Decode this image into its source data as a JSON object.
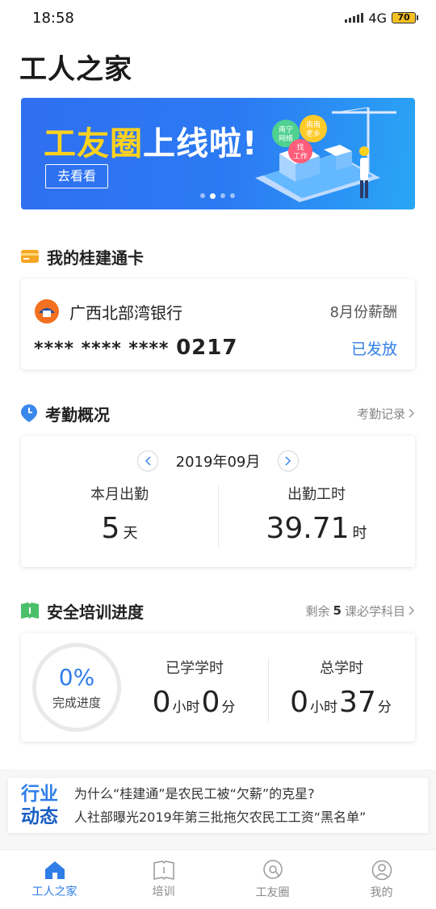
{
  "status": {
    "time": "18:58",
    "network": "4G",
    "battery": "70"
  },
  "header": {
    "title": "工人之家"
  },
  "banner": {
    "headline_part1": "工友圈",
    "headline_part2": "上线啦",
    "headline_mark": "!",
    "cta": "去看看",
    "art_labels": [
      "南宁",
      "网络",
      "南南",
      "老乡",
      "找",
      "工作"
    ]
  },
  "card_section": {
    "title": "我的桂建通卡",
    "bank_name": "广西北部湾银行",
    "salary_label": "8月份薪酬",
    "card_mask": "**** **** ****",
    "card_last4": "0217",
    "status": "已发放"
  },
  "attendance": {
    "title": "考勤概况",
    "link": "考勤记录",
    "month": "2019年09月",
    "days_label": "本月出勤",
    "days_value": "5",
    "days_unit": "天",
    "hours_label": "出勤工时",
    "hours_value": "39.71",
    "hours_unit": "时"
  },
  "training": {
    "title": "安全培训进度",
    "link_prefix": "剩余",
    "link_count": "5",
    "link_suffix": "课必学科目",
    "progress_value": "0%",
    "progress_label": "完成进度",
    "learned_label": "已学学时",
    "learned_hours": "0",
    "learned_minutes": "0",
    "total_label": "总学时",
    "total_hours": "0",
    "total_minutes": "37",
    "hour_unit": "小时",
    "minute_unit": "分"
  },
  "news": {
    "tag_line1": "行业",
    "tag_line2": "动态",
    "items": [
      "为什么“桂建通”是农民工被“欠薪”的克星?",
      "人社部曝光2019年第三批拖欠农民工工资“黑名单”"
    ]
  },
  "tabs": [
    {
      "label": "工人之家",
      "icon": "home-icon",
      "active": true
    },
    {
      "label": "培训",
      "icon": "book-icon",
      "active": false
    },
    {
      "label": "工友圈",
      "icon": "chat-icon",
      "active": false
    },
    {
      "label": "我的",
      "icon": "profile-icon",
      "active": false
    }
  ],
  "colors": {
    "accent": "#2f7ee8",
    "banner_yellow": "#ffd21d",
    "card_icon": "#f5a623",
    "book_icon": "#4cbf6b"
  }
}
